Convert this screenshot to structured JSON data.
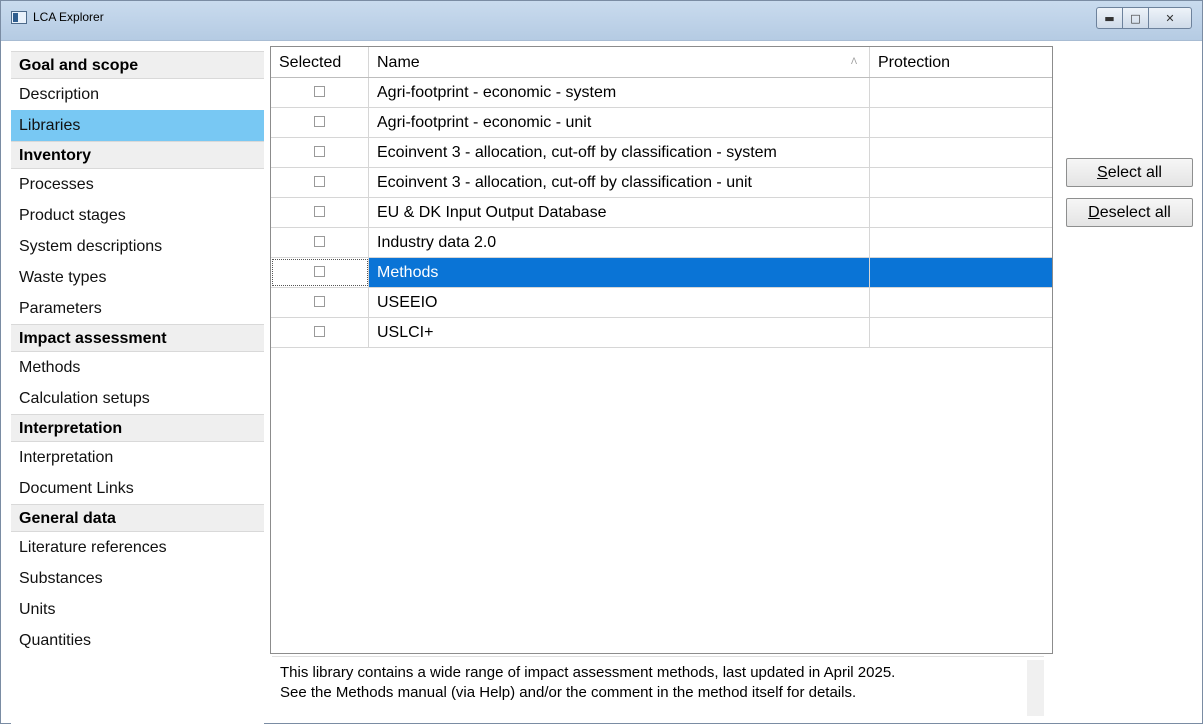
{
  "window": {
    "title": "LCA Explorer"
  },
  "sidebar": {
    "sections": [
      {
        "header": "Goal and scope",
        "items": [
          "Description",
          "Libraries"
        ]
      },
      {
        "header": "Inventory",
        "items": [
          "Processes",
          "Product stages",
          "System descriptions",
          "Waste types",
          "Parameters"
        ]
      },
      {
        "header": "Impact assessment",
        "items": [
          "Methods",
          "Calculation setups"
        ]
      },
      {
        "header": "Interpretation",
        "items": [
          "Interpretation",
          "Document Links"
        ]
      },
      {
        "header": "General data",
        "items": [
          "Literature references",
          "Substances",
          "Units",
          "Quantities"
        ]
      }
    ],
    "active_item": "Libraries"
  },
  "table": {
    "columns": [
      "Selected",
      "Name",
      "Protection"
    ],
    "rows": [
      {
        "selected": false,
        "name": "Agri-footprint - economic - system",
        "protection": ""
      },
      {
        "selected": false,
        "name": "Agri-footprint - economic - unit",
        "protection": ""
      },
      {
        "selected": false,
        "name": "Ecoinvent 3 - allocation, cut-off by classification - system",
        "protection": ""
      },
      {
        "selected": false,
        "name": "Ecoinvent 3 - allocation, cut-off by classification - unit",
        "protection": ""
      },
      {
        "selected": false,
        "name": "EU & DK Input Output Database",
        "protection": ""
      },
      {
        "selected": false,
        "name": "Industry data 2.0",
        "protection": ""
      },
      {
        "selected": false,
        "name": "Methods",
        "protection": ""
      },
      {
        "selected": false,
        "name": "USEEIO",
        "protection": ""
      },
      {
        "selected": false,
        "name": "USLCI+",
        "protection": ""
      }
    ],
    "highlighted_row": 6
  },
  "description": {
    "line1": "This library contains a wide range of impact assessment methods, last updated in April 2025.",
    "line2": "See the Methods manual (via Help) and/or the comment in the method itself for details."
  },
  "buttons": {
    "select_all": {
      "mnemonic": "S",
      "rest": "elect all"
    },
    "deselect_all": {
      "mnemonic": "D",
      "rest": "eselect all"
    }
  },
  "colors": {
    "highlight": "#0a74d6",
    "active_nav": "#78c8f3"
  }
}
